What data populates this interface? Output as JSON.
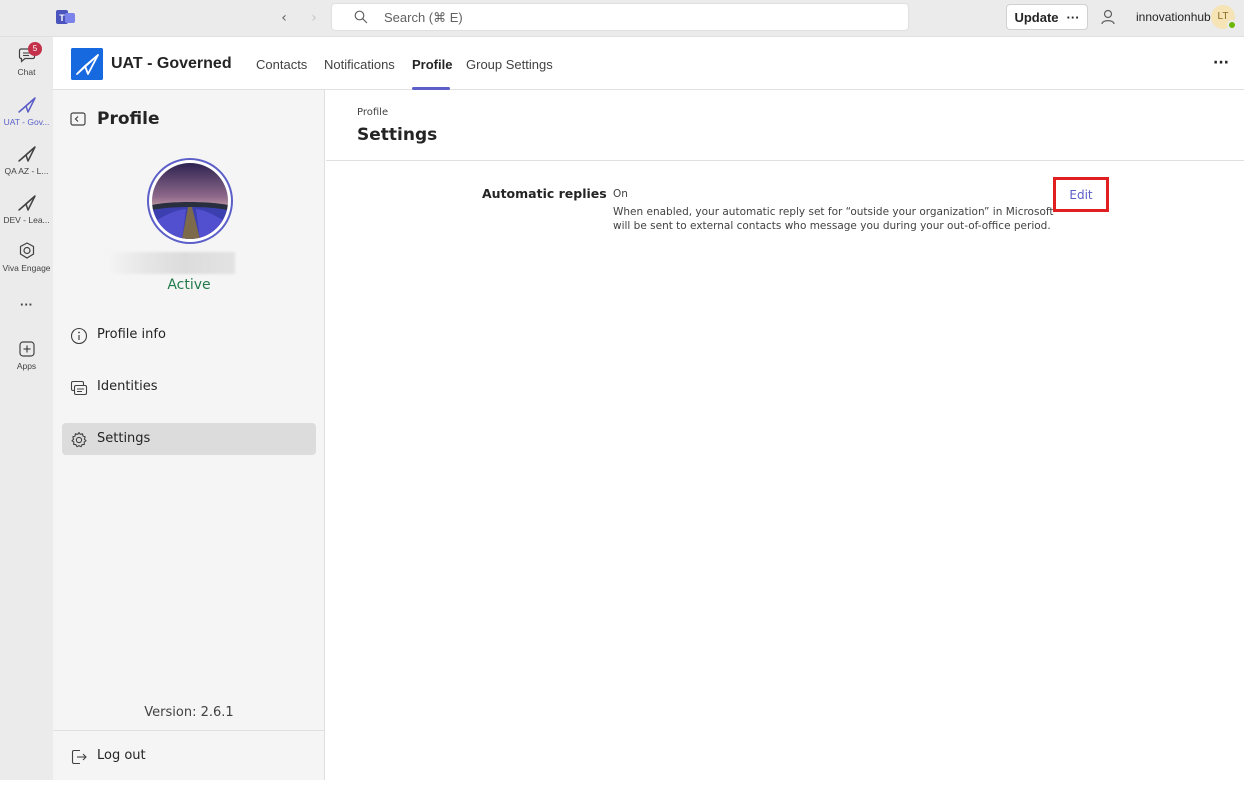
{
  "topbar": {
    "search_placeholder": "Search (⌘ E)",
    "update_label": "Update",
    "update_more": "···",
    "org_name": "innovationhub",
    "user_initials": "LT"
  },
  "rail": {
    "chat_label": "Chat",
    "chat_badge": "5",
    "uat_label": "UAT - Gov...",
    "qa_label": "QA AZ - L...",
    "dev_label": "DEV - Lea...",
    "viva_label": "Viva Engage",
    "more_label": "···",
    "apps_label": "Apps"
  },
  "header": {
    "app_title": "UAT - Governed",
    "tabs": [
      {
        "label": "Contacts"
      },
      {
        "label": "Notifications"
      },
      {
        "label": "Profile"
      },
      {
        "label": "Group Settings"
      }
    ],
    "more": "···"
  },
  "left_panel": {
    "title": "Profile",
    "status": "Active",
    "menu": [
      {
        "label": "Profile info"
      },
      {
        "label": "Identities"
      },
      {
        "label": "Settings"
      }
    ],
    "version": "Version: 2.6.1",
    "logout": "Log out"
  },
  "main": {
    "breadcrumb": "Profile",
    "title": "Settings",
    "setting": {
      "label": "Automatic replies",
      "value": "On",
      "description": "When enabled, your automatic reply set for “outside your organization” in Microsoft will be sent to external contacts who message you during your out-of-office period.",
      "edit_label": "Edit"
    }
  },
  "colors": {
    "accent": "#5b5fc7",
    "status_active": "#237b4b",
    "highlight_box": "#e02020",
    "badge": "#c4314b",
    "app_logo": "#1769e0"
  }
}
